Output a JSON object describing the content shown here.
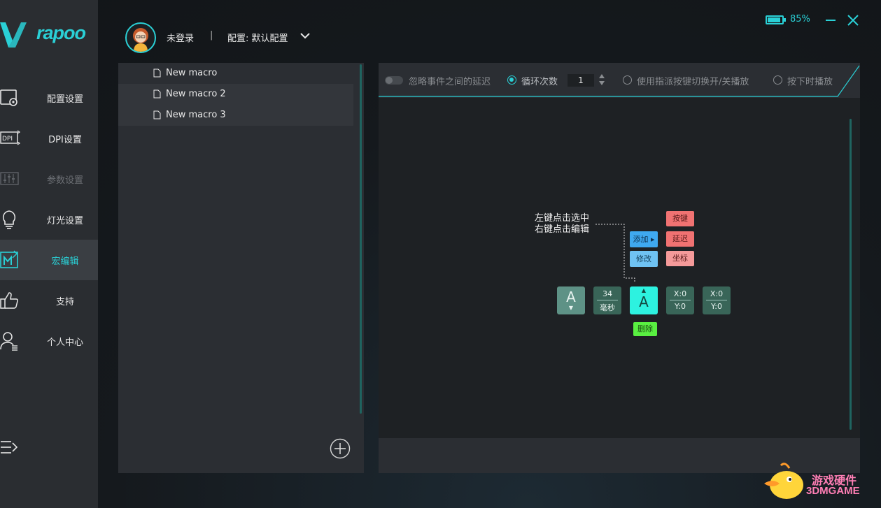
{
  "app": {
    "brand": "rapoo"
  },
  "sidebar": {
    "items": [
      {
        "label": "配置设置",
        "icon": "config-icon"
      },
      {
        "label": "DPI设置",
        "icon": "dpi-icon"
      },
      {
        "label": "参数设置",
        "icon": "sliders-icon",
        "disabled": true
      },
      {
        "label": "灯光设置",
        "icon": "bulb-icon"
      },
      {
        "label": "宏编辑",
        "icon": "macro-icon",
        "active": true
      },
      {
        "label": "支持",
        "icon": "thumbs-up-icon"
      },
      {
        "label": "个人中心",
        "icon": "user-icon"
      }
    ]
  },
  "header": {
    "user": "未登录",
    "separator": "|",
    "profile": "配置: 默认配置"
  },
  "status": {
    "battery": "85%"
  },
  "macro_list": {
    "items": [
      "New macro",
      "New macro 2",
      "New macro 3"
    ]
  },
  "toolbar": {
    "ignore_delay": "忽略事件之间的延迟",
    "loop_count_label": "循环次数",
    "loop_count_value": "1",
    "toggle_mode": "使用指派按键切换开/关播放",
    "hold_mode": "按下时播放"
  },
  "tutorial": {
    "hint_line1": "左键点击选中",
    "hint_line2": "右键点击编辑",
    "menu_add": "添加",
    "menu_modify": "修改",
    "sub_key": "按键",
    "sub_delay": "延迟",
    "sub_coord": "坐标",
    "key_letter": "A",
    "delay_value": "34",
    "delay_unit": "毫秒",
    "selected_letter": "A",
    "delete": "删除",
    "x_label": "X:0",
    "y_label": "Y:0"
  },
  "watermark": {
    "cn": "游戏硬件",
    "en": "3DMGAME"
  },
  "colors": {
    "accent": "#2ad0d6",
    "red": "#f07272",
    "blue": "#3fa9f0",
    "green": "#59f041"
  }
}
